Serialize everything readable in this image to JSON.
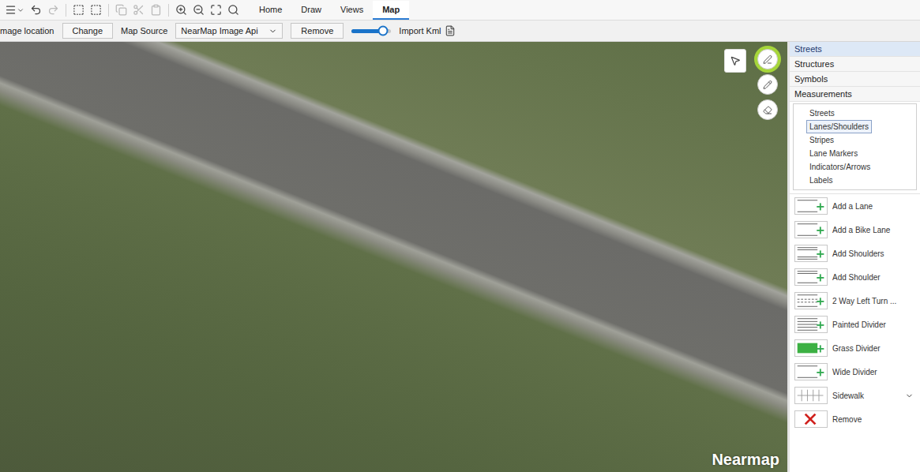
{
  "toolbar": {
    "buttons": [
      {
        "kind": "menu",
        "disabled": false
      },
      {
        "kind": "undo",
        "disabled": false
      },
      {
        "kind": "redo",
        "disabled": true
      },
      {
        "kind": "select",
        "disabled": false
      },
      {
        "kind": "select-area",
        "disabled": false
      },
      {
        "kind": "copy",
        "disabled": true
      },
      {
        "kind": "cut",
        "disabled": true
      },
      {
        "kind": "paste",
        "disabled": true
      },
      {
        "kind": "zoom-in",
        "disabled": false
      },
      {
        "kind": "zoom-out",
        "disabled": false
      },
      {
        "kind": "fit",
        "disabled": false
      },
      {
        "kind": "zoom-search",
        "disabled": false
      }
    ],
    "tabs": [
      {
        "label": "Home",
        "selected": false
      },
      {
        "label": "Draw",
        "selected": false
      },
      {
        "label": "Views",
        "selected": false
      },
      {
        "label": "Map",
        "selected": true
      }
    ]
  },
  "map_bar": {
    "location_label": "mage location",
    "change_button": "Change",
    "source_label": "Map Source",
    "source_value": "NearMap Image Api",
    "remove_button": "Remove",
    "opacity": {
      "level": 0.8
    },
    "import_label": "Import Kml"
  },
  "map": {
    "watermark": "Nearmap",
    "tools": [
      {
        "kind": "pointer",
        "selected": false
      },
      {
        "kind": "draw",
        "selected": true
      },
      {
        "kind": "edit",
        "selected": false
      },
      {
        "kind": "erase",
        "selected": false
      }
    ]
  },
  "panel": {
    "categories": [
      {
        "label": "Streets",
        "selected": true
      },
      {
        "label": "Structures",
        "selected": false
      },
      {
        "label": "Symbols",
        "selected": false
      },
      {
        "label": "Measurements",
        "selected": false
      }
    ],
    "subcategories": [
      {
        "label": "Streets",
        "selected": false
      },
      {
        "label": "Lanes/Shoulders",
        "selected": true
      },
      {
        "label": "Stripes",
        "selected": false
      },
      {
        "label": "Lane Markers",
        "selected": false
      },
      {
        "label": "Indicators/Arrows",
        "selected": false
      },
      {
        "label": "Labels",
        "selected": false
      }
    ],
    "tools": [
      {
        "label": "Add a Lane",
        "kind": "lane",
        "menu": false
      },
      {
        "label": "Add a Bike Lane",
        "kind": "bike",
        "menu": false
      },
      {
        "label": "Add Shoulders",
        "kind": "shoulders",
        "menu": false
      },
      {
        "label": "Add Shoulder",
        "kind": "shoulder",
        "menu": false
      },
      {
        "label": "2 Way Left Turn ...",
        "kind": "turn",
        "menu": false
      },
      {
        "label": "Painted Divider",
        "kind": "painted",
        "menu": false
      },
      {
        "label": "Grass Divider",
        "kind": "grass",
        "menu": false
      },
      {
        "label": "Wide Divider",
        "kind": "wide",
        "menu": false
      },
      {
        "label": "Sidewalk",
        "kind": "sidewalk",
        "menu": true
      },
      {
        "label": "Remove",
        "kind": "remove",
        "menu": false
      }
    ]
  }
}
